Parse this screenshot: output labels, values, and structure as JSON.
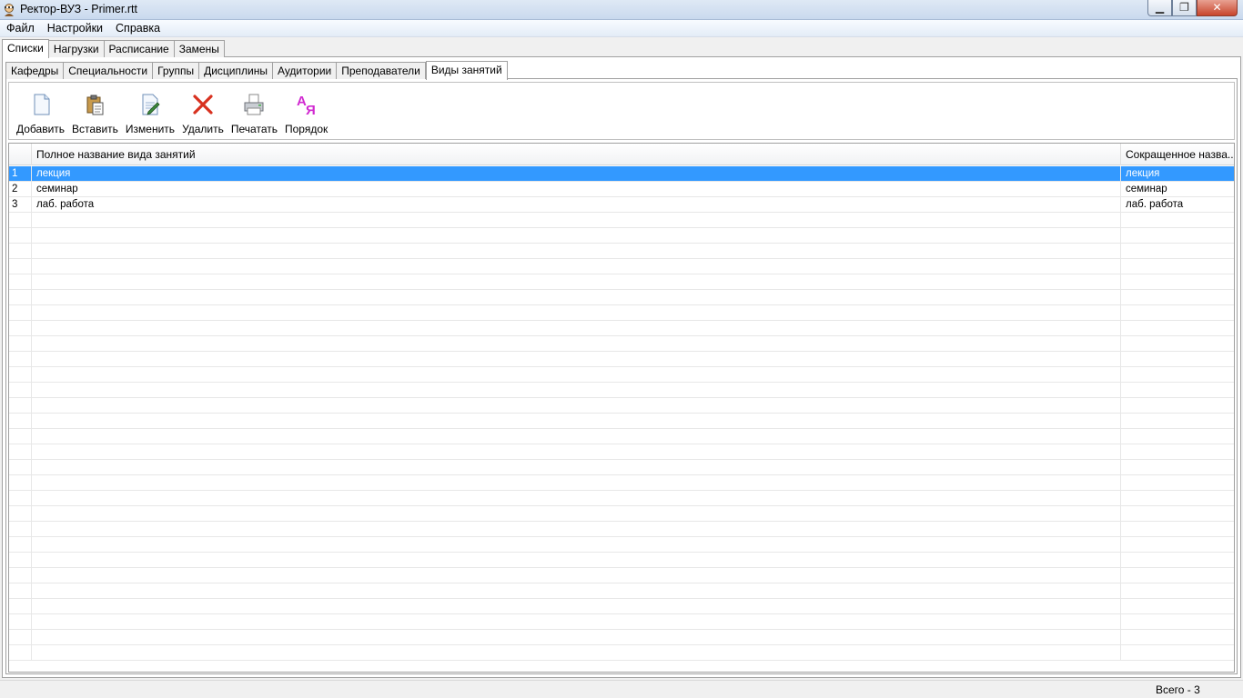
{
  "window": {
    "title": "Ректор-ВУЗ - Primer.rtt",
    "minimize_glyph": "▁",
    "maximize_glyph": "❐",
    "close_glyph": "✕"
  },
  "menu": [
    "Файл",
    "Настройки",
    "Справка"
  ],
  "main_tabs": [
    {
      "label": "Списки",
      "active": true
    },
    {
      "label": "Нагрузки",
      "active": false
    },
    {
      "label": "Расписание",
      "active": false
    },
    {
      "label": "Замены",
      "active": false
    }
  ],
  "sub_tabs": [
    {
      "label": "Кафедры",
      "active": false
    },
    {
      "label": "Специальности",
      "active": false
    },
    {
      "label": "Группы",
      "active": false
    },
    {
      "label": "Дисциплины",
      "active": false
    },
    {
      "label": "Аудитории",
      "active": false
    },
    {
      "label": "Преподаватели",
      "active": false
    },
    {
      "label": "Виды занятий",
      "active": true
    }
  ],
  "toolbar": [
    {
      "label": "Добавить",
      "icon": "new-document-icon"
    },
    {
      "label": "Вставить",
      "icon": "paste-icon"
    },
    {
      "label": "Изменить",
      "icon": "edit-icon"
    },
    {
      "label": "Удалить",
      "icon": "delete-icon"
    },
    {
      "label": "Печатать",
      "icon": "printer-icon"
    },
    {
      "label": "Порядок",
      "icon": "sort-order-icon"
    }
  ],
  "grid": {
    "columns": [
      "",
      "Полное название вида занятий",
      "Сокращенное назва..."
    ],
    "rows": [
      {
        "num": "1",
        "full": "лекция",
        "short": "лекция",
        "selected": true
      },
      {
        "num": "2",
        "full": "семинар",
        "short": "семинар",
        "selected": false
      },
      {
        "num": "3",
        "full": "лаб. работа",
        "short": "лаб. работа",
        "selected": false
      }
    ],
    "selection_color": "#3399ff"
  },
  "status": {
    "total": "Всего - 3"
  }
}
